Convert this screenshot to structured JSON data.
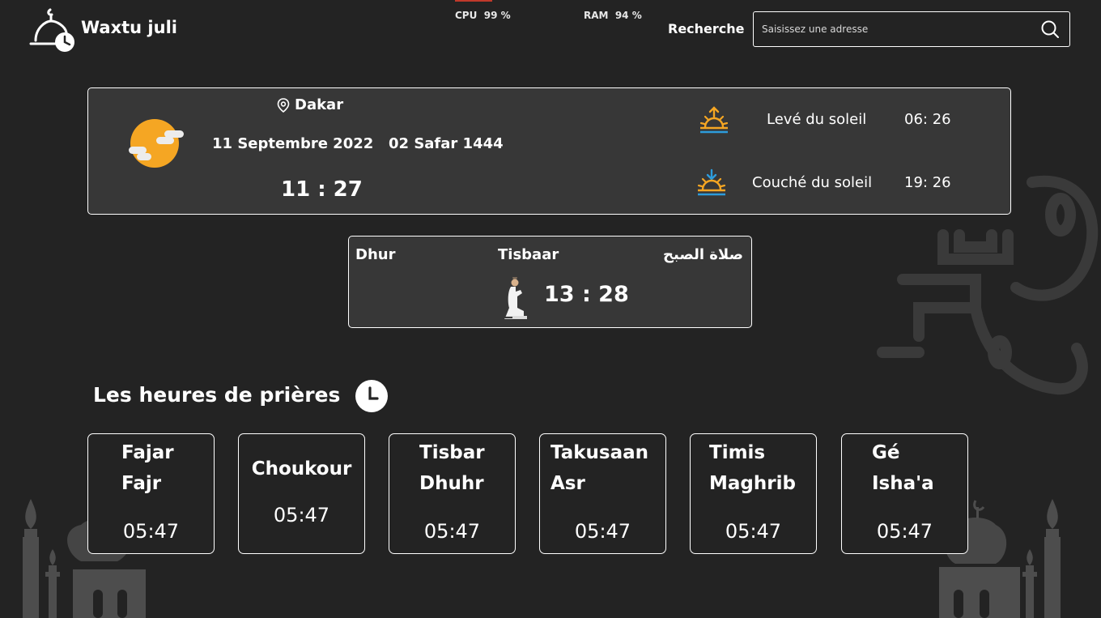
{
  "header": {
    "app_title": "Waxtu juli",
    "cpu": {
      "label": "CPU",
      "value": "99 %",
      "level": 0.99
    },
    "ram": {
      "label": "RAM",
      "value": "94 %",
      "level": 0.94
    },
    "search_label": "Recherche",
    "search_placeholder": "Saisissez une adresse",
    "search_value": "",
    "icons": {
      "logo": "mosque-clock-icon",
      "search": "search-icon"
    }
  },
  "weather": {
    "location": "Dakar",
    "date_gregorian": "11 Septembre 2022",
    "date_hijri": "02 Safar 1444",
    "time": "11 : 27",
    "sunrise_label": "Levé du soleil",
    "sunrise_time": "06: 26",
    "sunset_label": "Couché du soleil",
    "sunset_time": "19: 26",
    "icons": {
      "weather": "sun-cloud-icon",
      "location": "location-pin-icon",
      "sunrise": "sunrise-icon",
      "sunset": "sunset-icon"
    }
  },
  "current_prayer": {
    "name_wolof": "Dhur",
    "name_local": "Tisbaar",
    "name_arabic": "صلاة الصبح",
    "time": "13 : 28",
    "icon": "praying-man-icon"
  },
  "prayers_section": {
    "title": "Les heures de prières",
    "icon": "clock-icon"
  },
  "prayers": [
    {
      "name1": "Fajar",
      "name2": "Fajr",
      "time": "05:47"
    },
    {
      "name1": "Choukour",
      "name2": "",
      "time": "05:47"
    },
    {
      "name1": "Tisbar",
      "name2": "Dhuhr",
      "time": "05:47"
    },
    {
      "name1": "Takusaan",
      "name2": "Asr",
      "time": "05:47"
    },
    {
      "name1": "Timis",
      "name2": "Maghrib",
      "time": "05:47"
    },
    {
      "name1": "Gé",
      "name2": "Isha'a",
      "time": "05:47"
    }
  ],
  "colors": {
    "background": "#232323",
    "panel": "#373737",
    "sun_orange": "#f5a623",
    "sunrise_blue": "#2d9cdb",
    "decor": "#4a4a4a"
  }
}
